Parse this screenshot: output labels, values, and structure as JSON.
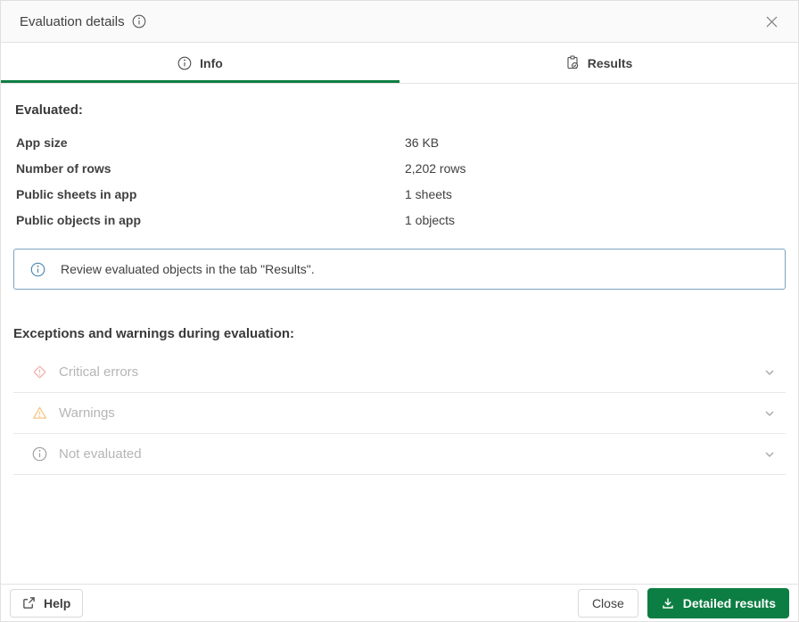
{
  "dialog": {
    "title": "Evaluation details"
  },
  "tabs": [
    {
      "label": "Info",
      "icon": "info-circle-icon",
      "active": true
    },
    {
      "label": "Results",
      "icon": "clipboard-check-icon",
      "active": false
    }
  ],
  "evaluated": {
    "heading": "Evaluated:",
    "rows": [
      {
        "label": "App size",
        "value": "36 KB"
      },
      {
        "label": "Number of rows",
        "value": "2,202 rows"
      },
      {
        "label": "Public sheets in app",
        "value": "1 sheets"
      },
      {
        "label": "Public objects in app",
        "value": "1 objects"
      }
    ]
  },
  "info_banner": {
    "icon": "info-circle-icon",
    "text": "Review evaluated objects in the tab \"Results\"."
  },
  "exceptions": {
    "heading": "Exceptions and warnings during evaluation:",
    "rows": [
      {
        "label": "Critical errors",
        "icon": "critical-diamond-icon"
      },
      {
        "label": "Warnings",
        "icon": "warning-triangle-icon"
      },
      {
        "label": "Not evaluated",
        "icon": "info-circle-icon"
      }
    ]
  },
  "footer": {
    "help_label": "Help",
    "close_label": "Close",
    "detailed_results_label": "Detailed results"
  },
  "colors": {
    "accent_green": "#0d7e43",
    "banner_border": "#7aa3c0",
    "banner_icon_blue": "#4a87ad",
    "critical_red": "#d94542",
    "warning_orange": "#ee9c34",
    "muted_text": "#b5b5b5"
  }
}
